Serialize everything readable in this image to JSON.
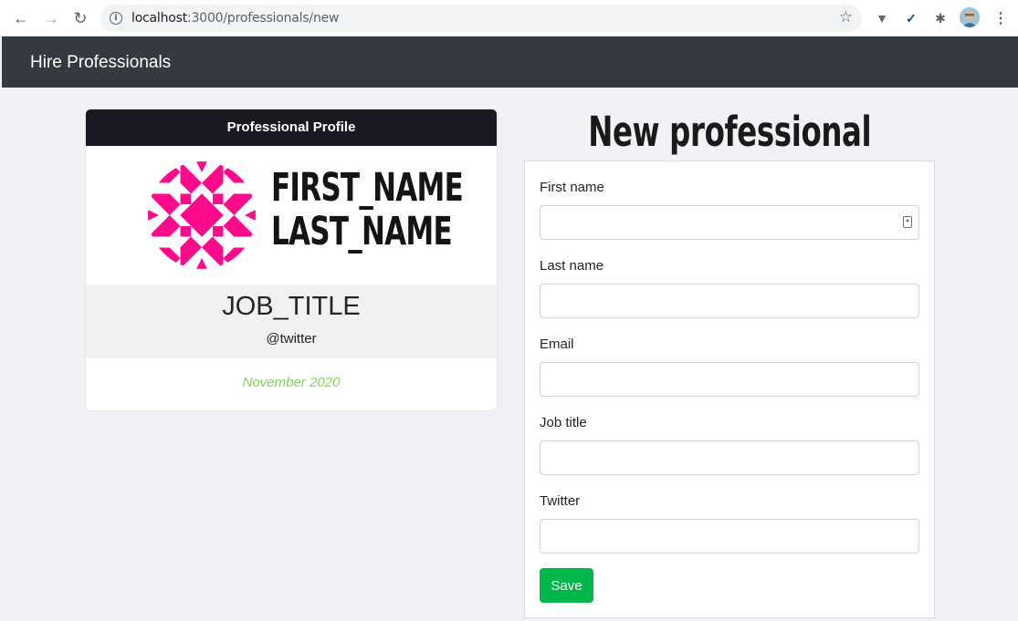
{
  "browser": {
    "url_host": "localhost",
    "url_path": ":3000/professionals/new"
  },
  "icons": {
    "back": "back-arrow-icon",
    "forward": "forward-arrow-icon",
    "reload": "reload-icon",
    "info": "info-icon",
    "star": "star-icon",
    "extension_1": "vue-devtools-icon",
    "extension_2": "extension-icon",
    "puzzle": "extensions-puzzle-icon",
    "menu": "kebab-menu-icon"
  },
  "navbar": {
    "brand": "Hire Professionals"
  },
  "profile_card": {
    "header": "Professional Profile",
    "first_name": "FIRST_NAME",
    "last_name": "LAST_NAME",
    "job_title": "JOB_TITLE",
    "twitter": "@twitter",
    "date": "November 2020"
  },
  "form": {
    "title": "New professional",
    "fields": [
      {
        "label": "First name",
        "value": ""
      },
      {
        "label": "Last name",
        "value": ""
      },
      {
        "label": "Email",
        "value": ""
      },
      {
        "label": "Job title",
        "value": ""
      },
      {
        "label": "Twitter",
        "value": ""
      }
    ],
    "submit_label": "Save"
  },
  "colors": {
    "navbar_bg": "#343a40",
    "card_header_bg": "#1b1821",
    "identicon": "#ff0a8a",
    "date_text": "#7ed957",
    "save_button": "#00b84a",
    "page_bg": "#f2f2f6"
  }
}
